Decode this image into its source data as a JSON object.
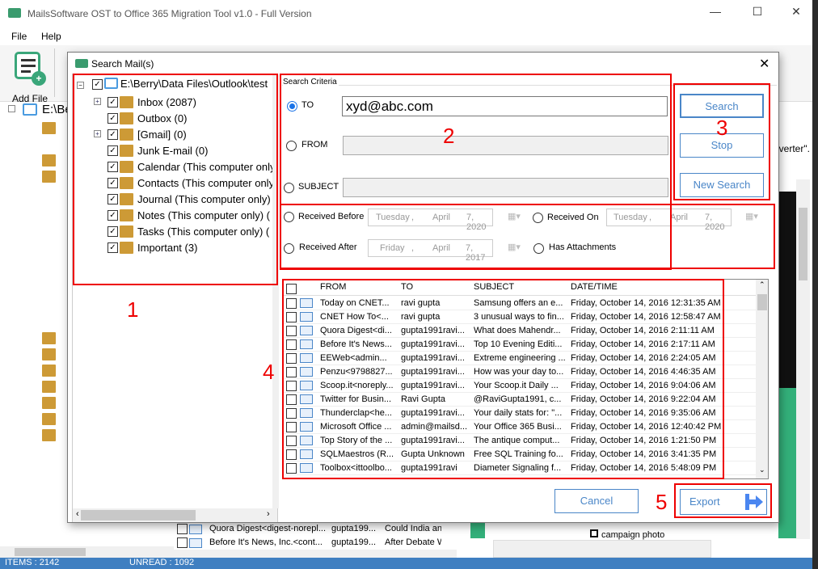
{
  "app": {
    "title": "MailsSoftware OST to Office 365 Migration Tool v1.0 - Full Version",
    "menu": [
      "File",
      "Help"
    ],
    "toolbar": {
      "add_file": "Add File"
    },
    "status": {
      "items": "ITEMS : 2142",
      "unread": "UNREAD : 1092"
    },
    "bg_tree_root": "E:\\Be",
    "bg_text": "nverter\".",
    "bg_rows": [
      {
        "from": "Quora Digest<digest-norepl...",
        "to": "gupta199...",
        "subject": "Could India an"
      },
      {
        "from": "Before It's News, Inc.<cont...",
        "to": "gupta199...",
        "subject": "After Debate W"
      }
    ],
    "campaign": "campaign photo",
    "accent": "#3f7fc1"
  },
  "dialog": {
    "title": "Search Mail(s)",
    "tree": {
      "root": "E:\\Berry\\Data Files\\Outlook\\test",
      "items": [
        "Inbox (2087)",
        "Outbox (0)",
        "[Gmail] (0)",
        "Junk E-mail (0)",
        "Calendar (This computer only)",
        "Contacts (This computer only)",
        "Journal (This computer only)",
        "Notes (This computer only) (",
        "Tasks (This computer only) (",
        "Important (3)"
      ]
    },
    "criteria": {
      "legend": "Search Criteria",
      "to_label": "TO",
      "to_value": "xyd@abc.com",
      "from_label": "FROM",
      "subject_label": "SUBJECT",
      "received_before": "Received Before",
      "received_on": "Received On",
      "received_after": "Received After",
      "has_attachments": "Has Attachments",
      "before_date": {
        "day": "Tuesday",
        "month": "April",
        "date": "7, 2020"
      },
      "on_date": {
        "day": "Tuesday",
        "month": "April",
        "date": "7, 2020"
      },
      "after_date": {
        "day": "Friday",
        "month": "April",
        "date": "7, 2017"
      },
      "selected": "TO"
    },
    "buttons": {
      "search": "Search",
      "stop": "Stop",
      "new_search": "New Search",
      "cancel": "Cancel",
      "export": "Export"
    },
    "annotations": [
      "1",
      "2",
      "3",
      "4",
      "5"
    ],
    "grid": {
      "columns": [
        "FROM",
        "TO",
        "SUBJECT",
        "DATE/TIME"
      ],
      "rows": [
        {
          "icon": "meeting",
          "from": "Today on CNET...",
          "to": "ravi gupta",
          "subject": "Samsung offers an e...",
          "date": "Friday, October 14, 2016 12:31:35 AM"
        },
        {
          "icon": "mail",
          "from": "CNET How To<...",
          "to": "ravi gupta",
          "subject": "3 unusual ways to fin...",
          "date": "Friday, October 14, 2016 12:58:47 AM"
        },
        {
          "icon": "mail",
          "from": "Quora Digest<di...",
          "to": "gupta1991ravi...",
          "subject": "What does Mahendr...",
          "date": "Friday, October 14, 2016 2:11:11 AM"
        },
        {
          "icon": "mail",
          "from": "Before It's News...",
          "to": "gupta1991ravi...",
          "subject": "Top 10 Evening Editi...",
          "date": "Friday, October 14, 2016 2:17:11 AM"
        },
        {
          "icon": "mail",
          "from": "EEWeb<admin...",
          "to": "gupta1991ravi...",
          "subject": "Extreme engineering ...",
          "date": "Friday, October 14, 2016 2:24:05 AM"
        },
        {
          "icon": "mail",
          "from": "Penzu<9798827...",
          "to": "gupta1991ravi...",
          "subject": "How was your day to...",
          "date": "Friday, October 14, 2016 4:46:35 AM"
        },
        {
          "icon": "meeting",
          "from": "Scoop.it<noreply...",
          "to": "gupta1991ravi...",
          "subject": "Your Scoop.it Daily ...",
          "date": "Friday, October 14, 2016 9:04:06 AM"
        },
        {
          "icon": "mail",
          "from": "Twitter for Busin...",
          "to": "Ravi Gupta",
          "subject": "@RaviGupta1991, c...",
          "date": "Friday, October 14, 2016 9:22:04 AM"
        },
        {
          "icon": "mail",
          "from": "Thunderclap<he...",
          "to": "gupta1991ravi...",
          "subject": "Your daily stats for: \"...",
          "date": "Friday, October 14, 2016 9:35:06 AM"
        },
        {
          "icon": "meeting",
          "from": "Microsoft Office ...",
          "to": "admin@mailsd...",
          "subject": "Your Office 365 Busi...",
          "date": "Friday, October 14, 2016 12:40:42 PM"
        },
        {
          "icon": "mail",
          "from": "Top Story of the ...",
          "to": "gupta1991ravi...",
          "subject": "The antique comput...",
          "date": "Friday, October 14, 2016 1:21:50 PM"
        },
        {
          "icon": "mail",
          "from": "SQLMaestros (R...",
          "to": "Gupta Unknown",
          "subject": "Free SQL Training fo...",
          "date": "Friday, October 14, 2016 3:41:35 PM"
        },
        {
          "icon": "mail",
          "from": "Toolbox<ittoolbo...",
          "to": "gupta1991ravi",
          "subject": "Diameter Signaling f...",
          "date": "Friday, October 14, 2016 5:48:09 PM"
        }
      ]
    }
  }
}
